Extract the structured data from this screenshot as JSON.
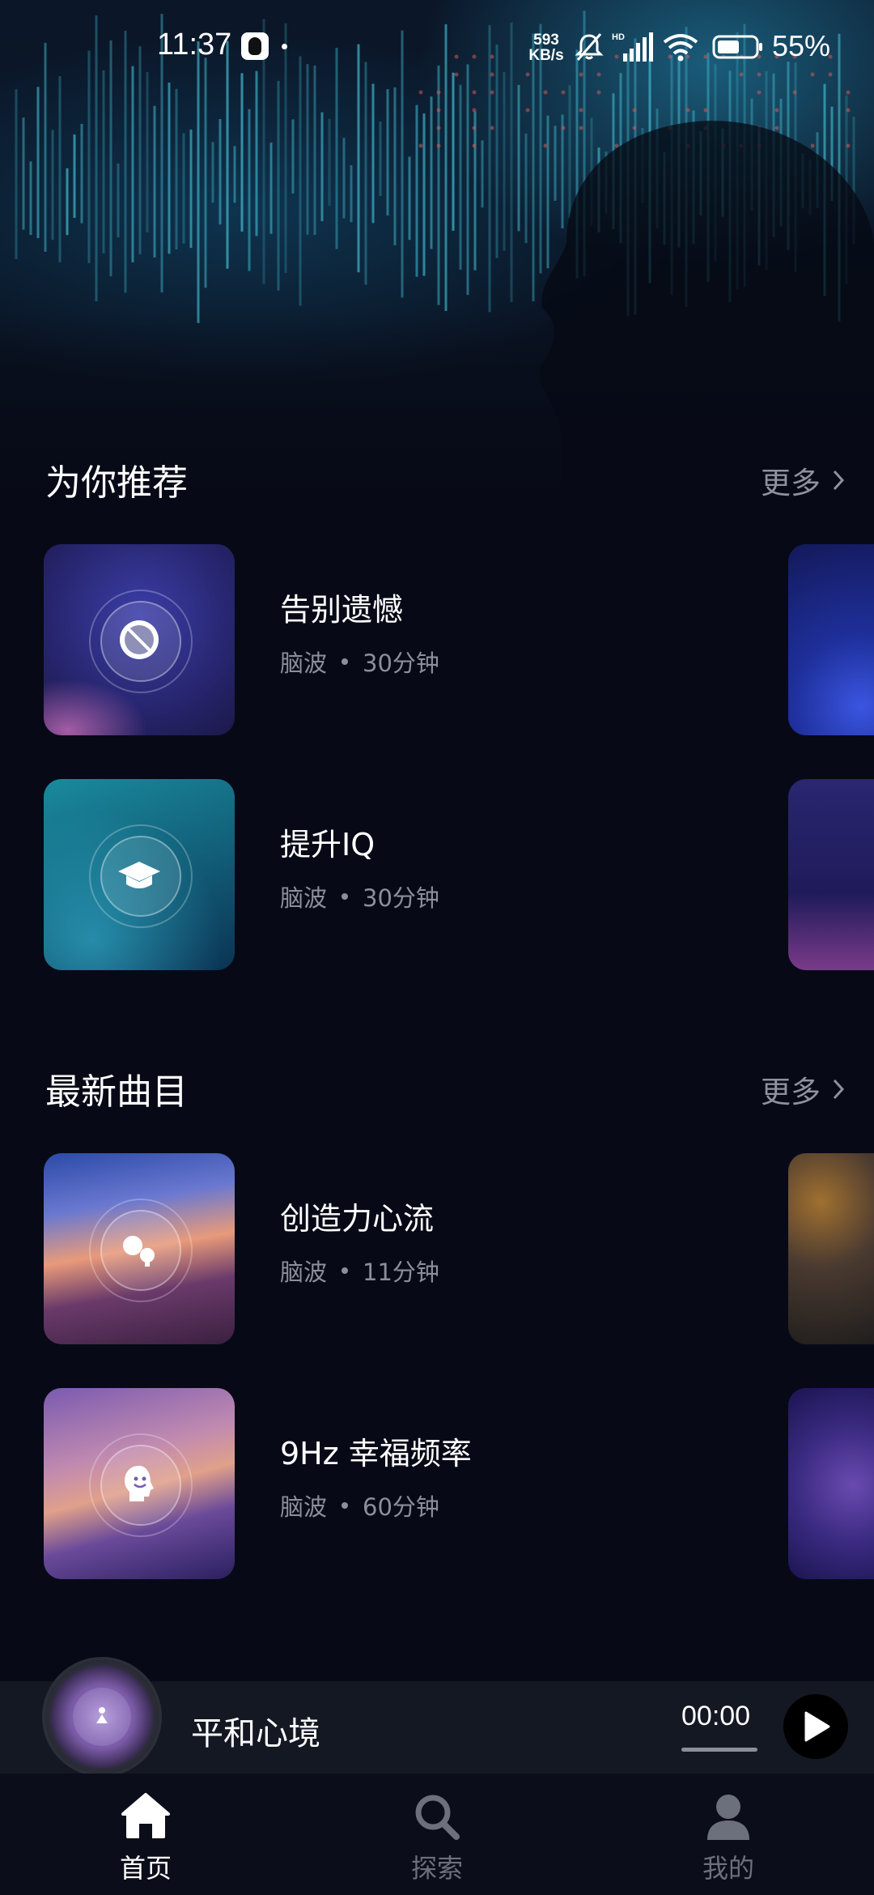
{
  "status_bar": {
    "time": "11:37",
    "net_speed_value": "593",
    "net_speed_unit": "KB/s",
    "network_type": "HD",
    "battery_percent": "55%",
    "icons": [
      "qq-icon",
      "mute-icon",
      "signal-icon",
      "wifi-icon",
      "battery-icon"
    ]
  },
  "sections": {
    "recommended": {
      "title": "为你推荐",
      "more_label": "更多",
      "tracks": [
        {
          "title": "告别遗憾",
          "category": "脑波",
          "duration": "30分钟",
          "icon": "no-regrets-icon"
        },
        {
          "title": "提升IQ",
          "category": "脑波",
          "duration": "30分钟",
          "icon": "graduation-cap-icon"
        }
      ]
    },
    "latest": {
      "title": "最新曲目",
      "more_label": "更多",
      "tracks": [
        {
          "title": "创造力心流",
          "category": "脑波",
          "duration": "11分钟",
          "icon": "creativity-icon"
        },
        {
          "title": "9Hz 幸福频率",
          "category": "脑波",
          "duration": "60分钟",
          "icon": "smiling-head-icon"
        }
      ]
    }
  },
  "mini_player": {
    "title": "平和心境",
    "time": "00:00",
    "progress": 0
  },
  "bottom_nav": {
    "items": [
      {
        "label": "首页",
        "icon": "home-icon",
        "active": true
      },
      {
        "label": "探索",
        "icon": "search-icon",
        "active": false
      },
      {
        "label": "我的",
        "icon": "profile-icon",
        "active": false
      }
    ]
  },
  "colors": {
    "background": "#070a16",
    "muted_text": "#8b8f9b",
    "active_nav": "#ffffff",
    "inactive_nav": "#6c707c"
  }
}
